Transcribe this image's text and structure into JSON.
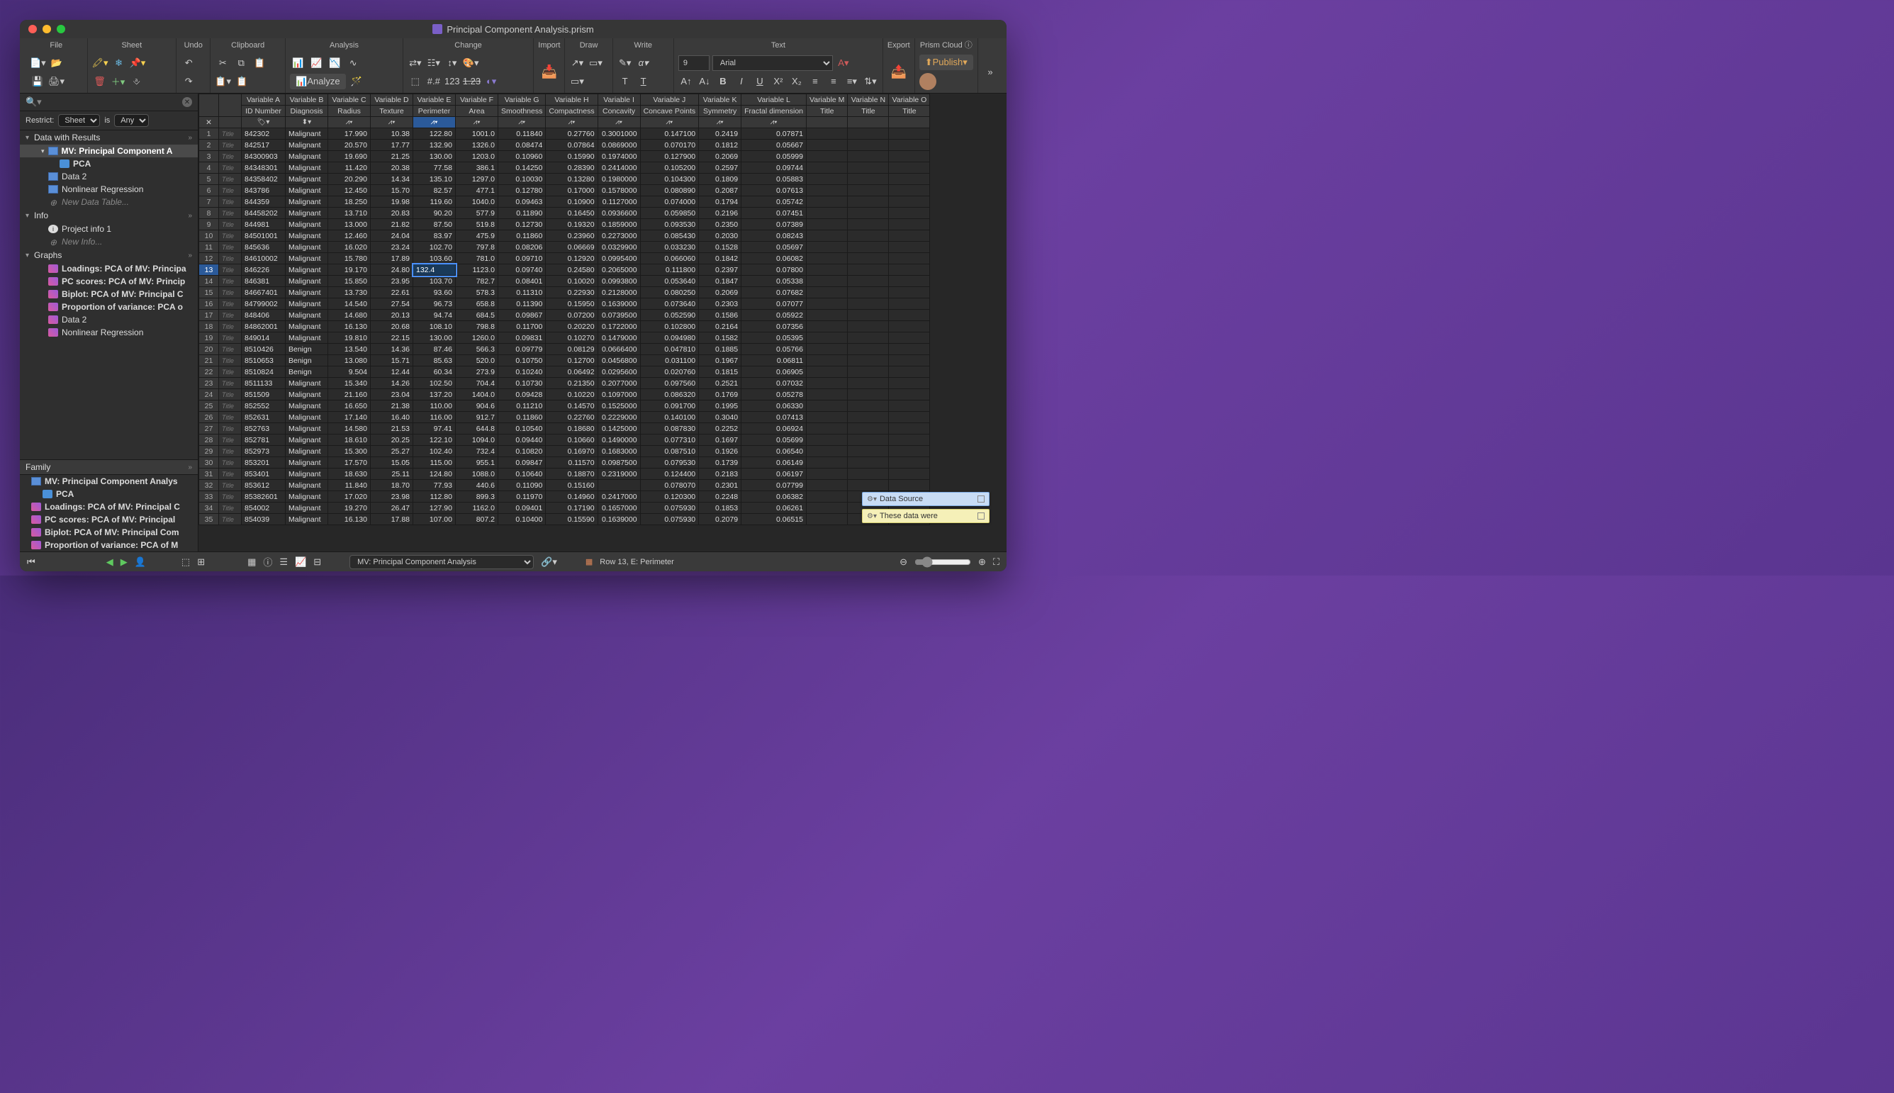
{
  "title": "Principal Component Analysis.prism",
  "toolbar": {
    "groups": [
      "File",
      "Sheet",
      "Undo",
      "Clipboard",
      "Analysis",
      "Change",
      "Import",
      "Draw",
      "Write",
      "Text",
      "Export",
      "Prism Cloud"
    ],
    "analyze_label": "Analyze",
    "publish_label": "Publish",
    "font_size": "9",
    "font_name": "Arial"
  },
  "sidebar": {
    "restrict_label": "Restrict:",
    "restrict_sheet": "Sheet",
    "restrict_is": "is",
    "restrict_any": "Any",
    "sections": {
      "data": "Data with Results",
      "info": "Info",
      "graphs": "Graphs",
      "family": "Family"
    },
    "data_items": [
      "MV: Principal Component A",
      "PCA",
      "Data 2",
      "Nonlinear Regression"
    ],
    "new_data": "New Data Table...",
    "info_items": [
      "Project info 1"
    ],
    "new_info": "New Info...",
    "graph_items": [
      "Loadings: PCA of MV: Principa",
      "PC scores: PCA of MV: Princip",
      "Biplot: PCA of MV: Principal C",
      "Proportion of variance: PCA o",
      "Data 2",
      "Nonlinear Regression"
    ],
    "family_items": [
      "MV: Principal Component Analys",
      "PCA",
      "Loadings: PCA of MV: Principal C",
      "PC scores: PCA of MV: Principal",
      "Biplot: PCA of MV: Principal Com",
      "Proportion of variance: PCA of M"
    ]
  },
  "columns": {
    "var_labels": [
      "Variable A",
      "Variable B",
      "Variable C",
      "Variable D",
      "Variable E",
      "Variable F",
      "Variable G",
      "Variable H",
      "Variable I",
      "Variable J",
      "Variable K",
      "Variable L",
      "Variable M",
      "Variable N",
      "Variable O"
    ],
    "names": [
      "ID Number",
      "Diagnosis",
      "Radius",
      "Texture",
      "Perimeter",
      "Area",
      "Smoothness",
      "Compactness",
      "Concavity",
      "Concave Points",
      "Symmetry",
      "Fractal dimension",
      "Title",
      "Title",
      "Title"
    ]
  },
  "editing_cell": {
    "row": 13,
    "col": 4,
    "value": "132.4"
  },
  "rows": [
    {
      "n": 1,
      "id": "842302",
      "diag": "Malignant",
      "v": [
        "17.990",
        "10.38",
        "122.80",
        "1001.0",
        "0.11840",
        "0.27760",
        "0.3001000",
        "0.147100",
        "0.2419",
        "0.07871"
      ]
    },
    {
      "n": 2,
      "id": "842517",
      "diag": "Malignant",
      "v": [
        "20.570",
        "17.77",
        "132.90",
        "1326.0",
        "0.08474",
        "0.07864",
        "0.0869000",
        "0.070170",
        "0.1812",
        "0.05667"
      ]
    },
    {
      "n": 3,
      "id": "84300903",
      "diag": "Malignant",
      "v": [
        "19.690",
        "21.25",
        "130.00",
        "1203.0",
        "0.10960",
        "0.15990",
        "0.1974000",
        "0.127900",
        "0.2069",
        "0.05999"
      ]
    },
    {
      "n": 4,
      "id": "84348301",
      "diag": "Malignant",
      "v": [
        "11.420",
        "20.38",
        "77.58",
        "386.1",
        "0.14250",
        "0.28390",
        "0.2414000",
        "0.105200",
        "0.2597",
        "0.09744"
      ]
    },
    {
      "n": 5,
      "id": "84358402",
      "diag": "Malignant",
      "v": [
        "20.290",
        "14.34",
        "135.10",
        "1297.0",
        "0.10030",
        "0.13280",
        "0.1980000",
        "0.104300",
        "0.1809",
        "0.05883"
      ]
    },
    {
      "n": 6,
      "id": "843786",
      "diag": "Malignant",
      "v": [
        "12.450",
        "15.70",
        "82.57",
        "477.1",
        "0.12780",
        "0.17000",
        "0.1578000",
        "0.080890",
        "0.2087",
        "0.07613"
      ]
    },
    {
      "n": 7,
      "id": "844359",
      "diag": "Malignant",
      "v": [
        "18.250",
        "19.98",
        "119.60",
        "1040.0",
        "0.09463",
        "0.10900",
        "0.1127000",
        "0.074000",
        "0.1794",
        "0.05742"
      ]
    },
    {
      "n": 8,
      "id": "84458202",
      "diag": "Malignant",
      "v": [
        "13.710",
        "20.83",
        "90.20",
        "577.9",
        "0.11890",
        "0.16450",
        "0.0936600",
        "0.059850",
        "0.2196",
        "0.07451"
      ]
    },
    {
      "n": 9,
      "id": "844981",
      "diag": "Malignant",
      "v": [
        "13.000",
        "21.82",
        "87.50",
        "519.8",
        "0.12730",
        "0.19320",
        "0.1859000",
        "0.093530",
        "0.2350",
        "0.07389"
      ]
    },
    {
      "n": 10,
      "id": "84501001",
      "diag": "Malignant",
      "v": [
        "12.460",
        "24.04",
        "83.97",
        "475.9",
        "0.11860",
        "0.23960",
        "0.2273000",
        "0.085430",
        "0.2030",
        "0.08243"
      ]
    },
    {
      "n": 11,
      "id": "845636",
      "diag": "Malignant",
      "v": [
        "16.020",
        "23.24",
        "102.70",
        "797.8",
        "0.08206",
        "0.06669",
        "0.0329900",
        "0.033230",
        "0.1528",
        "0.05697"
      ]
    },
    {
      "n": 12,
      "id": "84610002",
      "diag": "Malignant",
      "v": [
        "15.780",
        "17.89",
        "103.60",
        "781.0",
        "0.09710",
        "0.12920",
        "0.0995400",
        "0.066060",
        "0.1842",
        "0.06082"
      ]
    },
    {
      "n": 13,
      "id": "846226",
      "diag": "Malignant",
      "v": [
        "19.170",
        "24.80",
        "",
        "1123.0",
        "0.09740",
        "0.24580",
        "0.2065000",
        "0.111800",
        "0.2397",
        "0.07800"
      ]
    },
    {
      "n": 14,
      "id": "846381",
      "diag": "Malignant",
      "v": [
        "15.850",
        "23.95",
        "103.70",
        "782.7",
        "0.08401",
        "0.10020",
        "0.0993800",
        "0.053640",
        "0.1847",
        "0.05338"
      ]
    },
    {
      "n": 15,
      "id": "84667401",
      "diag": "Malignant",
      "v": [
        "13.730",
        "22.61",
        "93.60",
        "578.3",
        "0.11310",
        "0.22930",
        "0.2128000",
        "0.080250",
        "0.2069",
        "0.07682"
      ]
    },
    {
      "n": 16,
      "id": "84799002",
      "diag": "Malignant",
      "v": [
        "14.540",
        "27.54",
        "96.73",
        "658.8",
        "0.11390",
        "0.15950",
        "0.1639000",
        "0.073640",
        "0.2303",
        "0.07077"
      ]
    },
    {
      "n": 17,
      "id": "848406",
      "diag": "Malignant",
      "v": [
        "14.680",
        "20.13",
        "94.74",
        "684.5",
        "0.09867",
        "0.07200",
        "0.0739500",
        "0.052590",
        "0.1586",
        "0.05922"
      ]
    },
    {
      "n": 18,
      "id": "84862001",
      "diag": "Malignant",
      "v": [
        "16.130",
        "20.68",
        "108.10",
        "798.8",
        "0.11700",
        "0.20220",
        "0.1722000",
        "0.102800",
        "0.2164",
        "0.07356"
      ]
    },
    {
      "n": 19,
      "id": "849014",
      "diag": "Malignant",
      "v": [
        "19.810",
        "22.15",
        "130.00",
        "1260.0",
        "0.09831",
        "0.10270",
        "0.1479000",
        "0.094980",
        "0.1582",
        "0.05395"
      ]
    },
    {
      "n": 20,
      "id": "8510426",
      "diag": "Benign",
      "v": [
        "13.540",
        "14.36",
        "87.46",
        "566.3",
        "0.09779",
        "0.08129",
        "0.0666400",
        "0.047810",
        "0.1885",
        "0.05766"
      ]
    },
    {
      "n": 21,
      "id": "8510653",
      "diag": "Benign",
      "v": [
        "13.080",
        "15.71",
        "85.63",
        "520.0",
        "0.10750",
        "0.12700",
        "0.0456800",
        "0.031100",
        "0.1967",
        "0.06811"
      ]
    },
    {
      "n": 22,
      "id": "8510824",
      "diag": "Benign",
      "v": [
        "9.504",
        "12.44",
        "60.34",
        "273.9",
        "0.10240",
        "0.06492",
        "0.0295600",
        "0.020760",
        "0.1815",
        "0.06905"
      ]
    },
    {
      "n": 23,
      "id": "8511133",
      "diag": "Malignant",
      "v": [
        "15.340",
        "14.26",
        "102.50",
        "704.4",
        "0.10730",
        "0.21350",
        "0.2077000",
        "0.097560",
        "0.2521",
        "0.07032"
      ]
    },
    {
      "n": 24,
      "id": "851509",
      "diag": "Malignant",
      "v": [
        "21.160",
        "23.04",
        "137.20",
        "1404.0",
        "0.09428",
        "0.10220",
        "0.1097000",
        "0.086320",
        "0.1769",
        "0.05278"
      ]
    },
    {
      "n": 25,
      "id": "852552",
      "diag": "Malignant",
      "v": [
        "16.650",
        "21.38",
        "110.00",
        "904.6",
        "0.11210",
        "0.14570",
        "0.1525000",
        "0.091700",
        "0.1995",
        "0.06330"
      ]
    },
    {
      "n": 26,
      "id": "852631",
      "diag": "Malignant",
      "v": [
        "17.140",
        "16.40",
        "116.00",
        "912.7",
        "0.11860",
        "0.22760",
        "0.2229000",
        "0.140100",
        "0.3040",
        "0.07413"
      ]
    },
    {
      "n": 27,
      "id": "852763",
      "diag": "Malignant",
      "v": [
        "14.580",
        "21.53",
        "97.41",
        "644.8",
        "0.10540",
        "0.18680",
        "0.1425000",
        "0.087830",
        "0.2252",
        "0.06924"
      ]
    },
    {
      "n": 28,
      "id": "852781",
      "diag": "Malignant",
      "v": [
        "18.610",
        "20.25",
        "122.10",
        "1094.0",
        "0.09440",
        "0.10660",
        "0.1490000",
        "0.077310",
        "0.1697",
        "0.05699"
      ]
    },
    {
      "n": 29,
      "id": "852973",
      "diag": "Malignant",
      "v": [
        "15.300",
        "25.27",
        "102.40",
        "732.4",
        "0.10820",
        "0.16970",
        "0.1683000",
        "0.087510",
        "0.1926",
        "0.06540"
      ]
    },
    {
      "n": 30,
      "id": "853201",
      "diag": "Malignant",
      "v": [
        "17.570",
        "15.05",
        "115.00",
        "955.1",
        "0.09847",
        "0.11570",
        "0.0987500",
        "0.079530",
        "0.1739",
        "0.06149"
      ]
    },
    {
      "n": 31,
      "id": "853401",
      "diag": "Malignant",
      "v": [
        "18.630",
        "25.11",
        "124.80",
        "1088.0",
        "0.10640",
        "0.18870",
        "0.2319000",
        "0.124400",
        "0.2183",
        "0.06197"
      ]
    },
    {
      "n": 32,
      "id": "853612",
      "diag": "Malignant",
      "v": [
        "11.840",
        "18.70",
        "77.93",
        "440.6",
        "0.11090",
        "0.15160",
        "",
        "0.078070",
        "0.2301",
        "0.07799"
      ]
    },
    {
      "n": 33,
      "id": "85382601",
      "diag": "Malignant",
      "v": [
        "17.020",
        "23.98",
        "112.80",
        "899.3",
        "0.11970",
        "0.14960",
        "0.2417000",
        "0.120300",
        "0.2248",
        "0.06382"
      ]
    },
    {
      "n": 34,
      "id": "854002",
      "diag": "Malignant",
      "v": [
        "19.270",
        "26.47",
        "127.90",
        "1162.0",
        "0.09401",
        "0.17190",
        "0.1657000",
        "0.075930",
        "0.1853",
        "0.06261"
      ]
    },
    {
      "n": 35,
      "id": "854039",
      "diag": "Malignant",
      "v": [
        "16.130",
        "17.88",
        "107.00",
        "807.2",
        "0.10400",
        "0.15590",
        "0.1639000",
        "0.075930",
        "0.2079",
        "0.06515"
      ]
    }
  ],
  "statusbar": {
    "sheet_name": "MV: Principal Component Analysis",
    "cell_ref": "Row 13, E: Perimeter"
  },
  "notes": {
    "blue": "Data Source",
    "yellow": "These data were"
  }
}
